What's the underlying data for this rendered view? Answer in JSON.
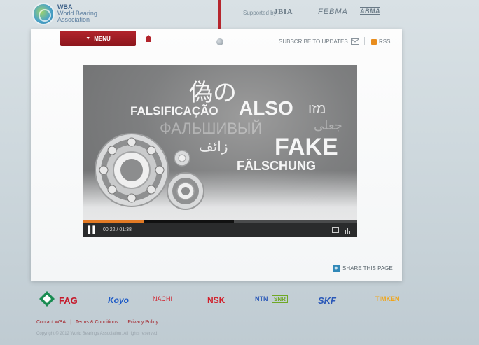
{
  "header": {
    "org_abbr": "WBA",
    "org_name_line1": "World Bearing",
    "org_name_line2": "Association",
    "supported_label": "Supported by:",
    "sponsors": [
      "JBIA",
      "FEBMA",
      "ABMA"
    ]
  },
  "nav": {
    "menu_label": "MENU",
    "subscribe_label": "SUBSCRIBE TO UPDATES",
    "rss_label": "RSS"
  },
  "video": {
    "texts": {
      "japanese": "偽の",
      "portuguese": "FALSIFICAÇÃO",
      "italian": "ALSO",
      "hebrew": "מזו",
      "russian": "ФАЛЬШИВЫЙ",
      "farsi": "جعلی",
      "arabic": "زائف",
      "english": "FAKE",
      "german": "FÄLSCHUNG"
    },
    "time_display": "00:22 / 01:38",
    "progress_fraction": 0.2245,
    "buffer_fraction": 0.55
  },
  "share": {
    "label": "SHARE THIS PAGE"
  },
  "footer": {
    "brands": [
      "FAG",
      "Koyo",
      "NACHI",
      "NSK",
      "NTN",
      "SNR",
      "SKF",
      "TIMKEN"
    ],
    "links": [
      "Contact WBA",
      "Terms & Conditions",
      "Privacy Policy"
    ],
    "copyright": "Copyright © 2012 World Bearings Association. All rights reserved."
  },
  "colors": {
    "menu_red": "#a51f27",
    "progress_orange": "#e37a24",
    "share_blue": "#3088b8"
  }
}
